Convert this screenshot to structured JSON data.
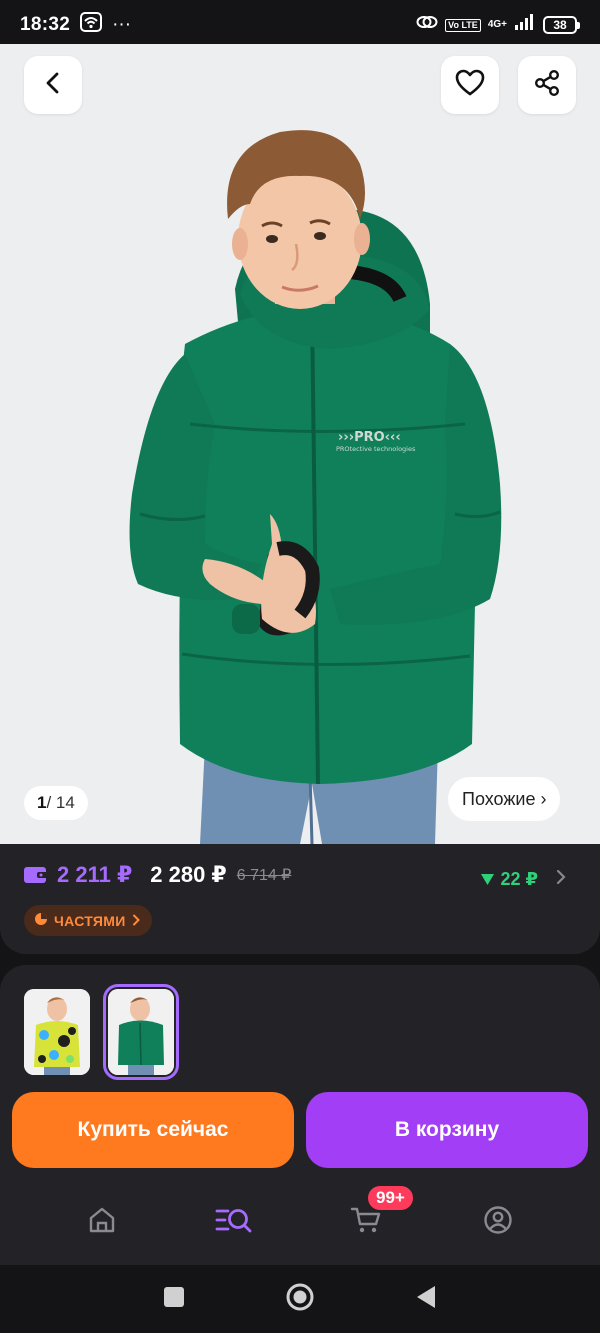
{
  "status_bar": {
    "time": "18:32",
    "dots": "···",
    "volte": "Vo LTE",
    "network": "4G+",
    "battery": "38"
  },
  "hero": {
    "counter_current": "1",
    "counter_total": "/ 14",
    "similar_label": "Похожие ›",
    "jacket_logo": "›››PRO‹‹‹",
    "jacket_logo_sub": "PROtective technologies",
    "jacket_color": "#10805a",
    "background_color": "#eceef0"
  },
  "price": {
    "wallet_price": "2 211 ₽",
    "price": "2 280 ₽",
    "old_price": "6 714 ₽",
    "cashback": "22 ₽",
    "installments_label": "ЧАСТЯМИ",
    "wallet_color": "#a56bff",
    "cashback_color": "#2fd07a"
  },
  "variants": [
    {
      "name": "camouflage-yellow",
      "selected": false
    },
    {
      "name": "green",
      "selected": true
    }
  ],
  "actions": {
    "buy_now": "Купить сейчас",
    "add_to_cart": "В корзину",
    "buy_color": "#ff7a1f",
    "cart_color": "#a23ff6"
  },
  "bottom_nav": {
    "items": [
      "home",
      "catalog",
      "cart",
      "profile"
    ],
    "cart_badge": "99+",
    "active": "catalog"
  }
}
